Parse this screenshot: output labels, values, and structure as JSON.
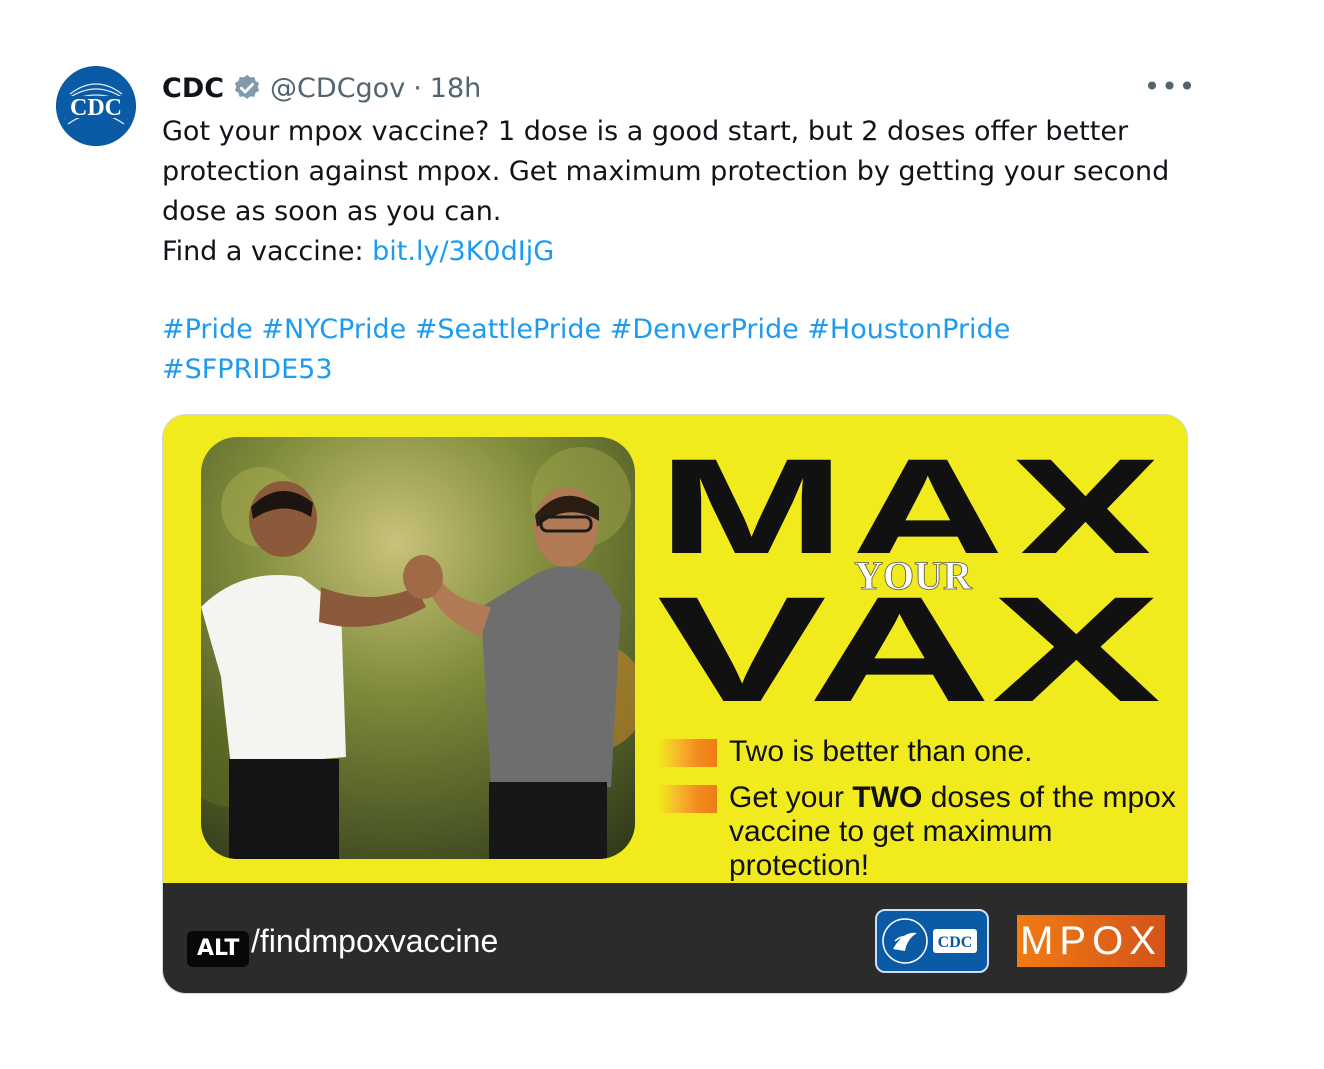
{
  "tweet": {
    "author": {
      "display_name": "CDC",
      "handle": "@CDCgov",
      "separator": "·",
      "time": "18h",
      "avatar_text": "CDC",
      "verified_icon": "verified-badge-icon"
    },
    "more_label": "•••",
    "text_lines": [
      "Got your mpox vaccine? 1 dose is a good start, but 2 doses offer better",
      "protection against mpox. Get maximum protection by getting your second",
      "dose as soon as you can."
    ],
    "find_label": "Find a vaccine: ",
    "find_link": "bit.ly/3K0dIjG",
    "hashtags_line1": "#Pride #NYCPride #SeattlePride #DenverPride #HoustonPride",
    "hashtags_line2": "#SFPRIDE53",
    "colors": {
      "link": "#1d9bf0",
      "text": "#0f1419",
      "muted": "#536471"
    }
  },
  "media": {
    "headline_top": "MAX",
    "headline_mid": "YOUR",
    "headline_bottom": "VAX",
    "bullet1": "Two is better than one.",
    "bullet2_pre": "Get your ",
    "bullet2_bold": "TWO",
    "bullet2_post": " doses of the mpox",
    "bullet2_line2": "vaccine to get maximum protection!",
    "footer_url": "/findmpoxvaccine",
    "alt_label": "ALT",
    "hhs_text": "CDC",
    "mpox_logo": "MPOX",
    "colors": {
      "background": "#f1ea1c",
      "footer": "#2b2b2b",
      "accent": "#f07b14"
    }
  }
}
